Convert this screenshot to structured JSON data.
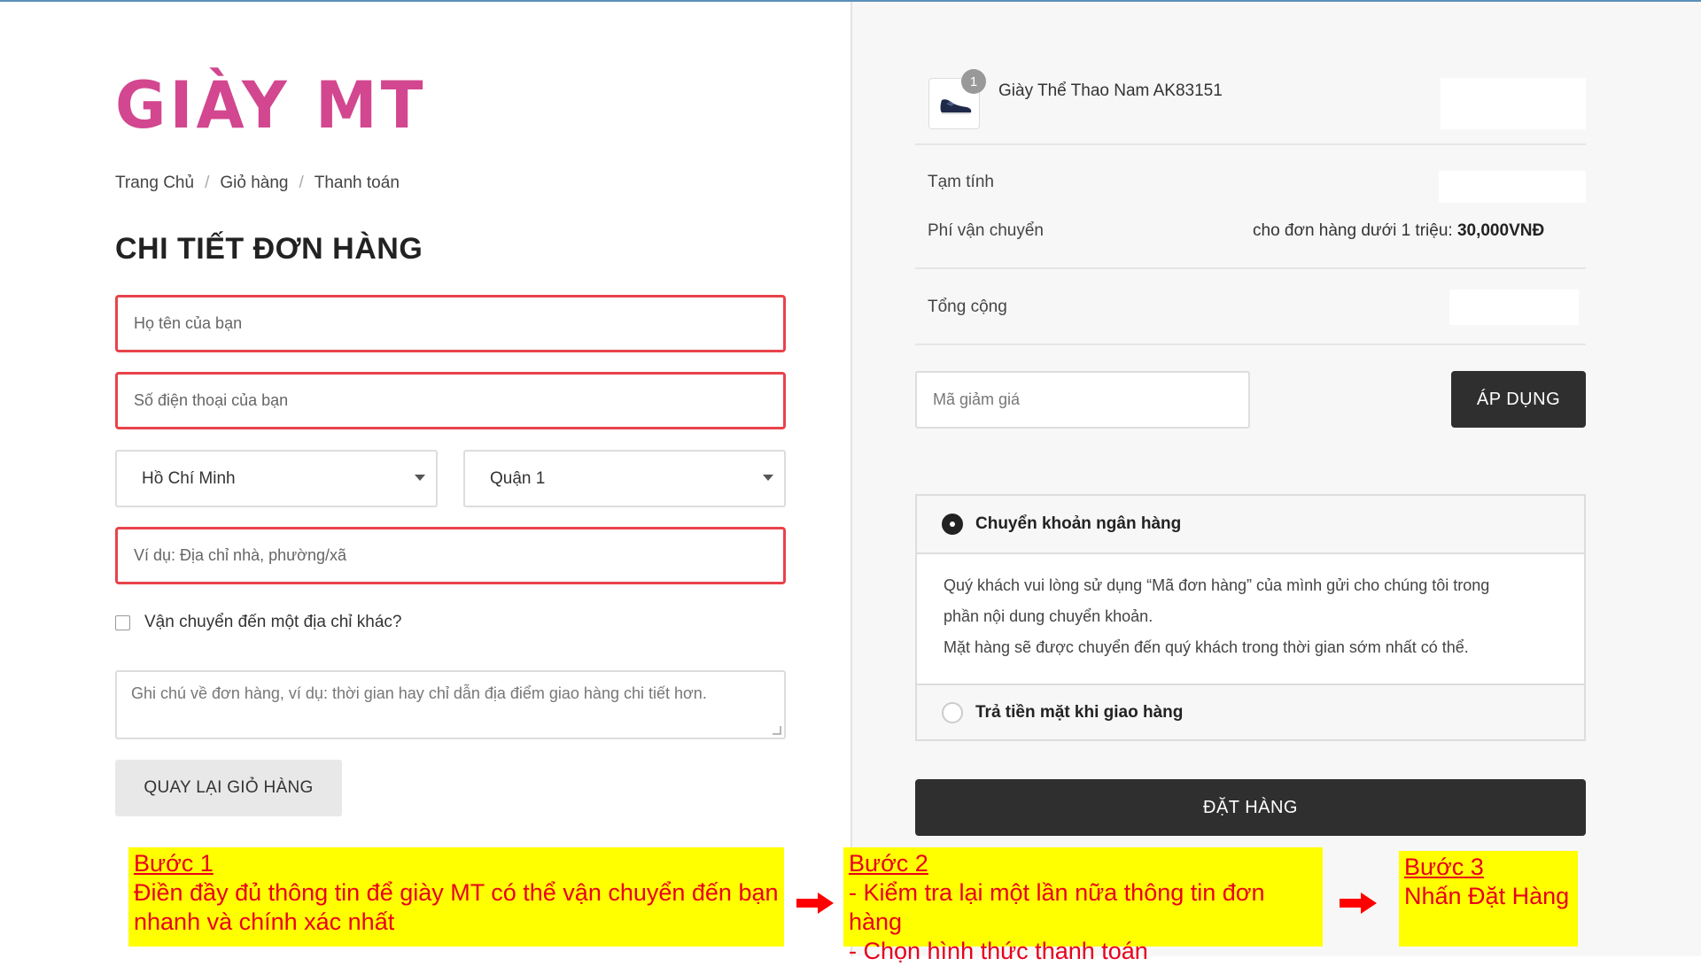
{
  "brand": {
    "logo": "GIÀY MT",
    "logo_color": "#d2478f"
  },
  "breadcrumb": [
    "Trang Chủ",
    "Giỏ hàng",
    "Thanh toán"
  ],
  "checkout": {
    "title": "CHI TIẾT ĐƠN HÀNG",
    "name_placeholder": "Họ tên của bạn",
    "phone_placeholder": "Số điện thoại của bạn",
    "city_value": "Hồ Chí Minh",
    "district_value": "Quận 1",
    "address_placeholder": "Ví dụ: Địa chỉ nhà, phường/xã",
    "ship_other_label": "Vận chuyển đến một địa chỉ khác?",
    "notes_placeholder": "Ghi chú về đơn hàng, ví dụ: thời gian hay chỉ dẫn địa điểm giao hàng chi tiết hơn.",
    "back_button": "QUAY LẠI GIỎ HÀNG"
  },
  "order": {
    "product_name": "Giày Thể Thao Nam AK83151",
    "quantity": "1",
    "subtotal_label": "Tạm tính",
    "shipping_label": "Phí vận chuyển",
    "shipping_note": "cho đơn hàng dưới 1 triệu:",
    "shipping_fee": "30,000VNĐ",
    "total_label": "Tổng cộng",
    "coupon_placeholder": "Mã giảm giá",
    "apply_button": "ÁP DỤNG",
    "payment_bank_label": "Chuyển khoản ngân hàng",
    "payment_bank_desc_1": "Quý khách vui lòng sử dụng “Mã đơn hàng” của mình gửi cho chúng tôi trong",
    "payment_bank_desc_2": "phần nội dung chuyển khoản.",
    "payment_bank_desc_3": "Mặt hàng sẽ được chuyển đến quý khách trong thời gian sớm nhất có thể.",
    "payment_cod_label": "Trả tiền mặt khi giao hàng",
    "order_button": "ĐẶT HÀNG"
  },
  "annotations": {
    "step1_title": "Bước 1",
    "step1_line1": "Điền đầy đủ thông tin để giày MT có thể vận chuyển đến bạn",
    "step1_line2": "nhanh và chính xác nhất",
    "step2_title": "Bước 2",
    "step2_line1": "- Kiểm tra lại một lần nữa thông tin đơn hàng",
    "step2_line2": "- Chọn hình thức thanh toán",
    "step3_title": "Bước 3",
    "step3_line1": "Nhấn Đặt Hàng",
    "highlight_color": "#ffff00",
    "text_color": "#e8001c"
  }
}
